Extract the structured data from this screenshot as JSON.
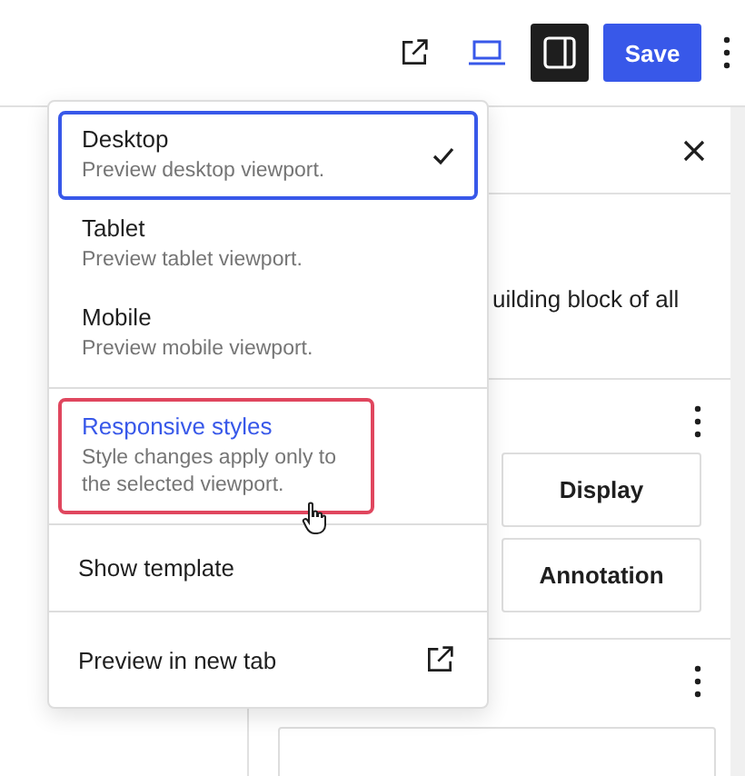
{
  "toolbar": {
    "view_active": true,
    "sidebar_open": true,
    "save_label": "Save"
  },
  "sidebar": {
    "description": "uilding block of all",
    "buttons": [
      "Display",
      "Annotation"
    ]
  },
  "menu": {
    "viewports": [
      {
        "title": "Desktop",
        "description": "Preview desktop viewport.",
        "selected": true
      },
      {
        "title": "Tablet",
        "description": "Preview tablet viewport.",
        "selected": false
      },
      {
        "title": "Mobile",
        "description": "Preview mobile viewport.",
        "selected": false
      }
    ],
    "responsive": {
      "title": "Responsive styles",
      "description": "Style changes apply only to the selected viewport.",
      "highlighted": true
    },
    "show_template": "Show template",
    "preview": "Preview in new tab"
  }
}
